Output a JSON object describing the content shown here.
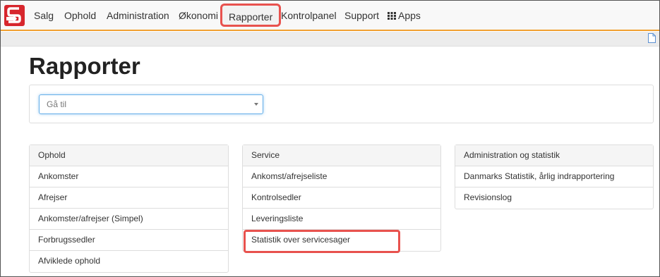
{
  "nav": {
    "items": [
      {
        "label": "Salg"
      },
      {
        "label": "Ophold"
      },
      {
        "label": "Administration"
      },
      {
        "label": "Økonomi"
      },
      {
        "label": "Rapporter"
      },
      {
        "label": "Kontrolpanel"
      },
      {
        "label": "Support"
      },
      {
        "label": "Apps"
      }
    ],
    "active": "Rapporter",
    "logo_icon": "brand-logo-icon",
    "apps_icon": "grid-icon",
    "accent_color": "#f0a030",
    "highlight_color": "#e8524e"
  },
  "page": {
    "title": "Rapporter",
    "goto": {
      "placeholder": "Gå til"
    }
  },
  "panels": [
    {
      "heading": "Ophold",
      "items": [
        "Ankomster",
        "Afrejser",
        "Ankomster/afrejser (Simpel)",
        "Forbrugssedler",
        "Afviklede ophold"
      ]
    },
    {
      "heading": "Service",
      "items": [
        "Ankomst/afrejseliste",
        "Kontrolsedler",
        "Leveringsliste",
        "Statistik over servicesager"
      ]
    },
    {
      "heading": "Administration og statistik",
      "items": [
        "Danmarks Statistik, årlig indrapportering",
        "Revisionslog"
      ]
    }
  ],
  "highlighted_report": "Statistik over servicesager"
}
